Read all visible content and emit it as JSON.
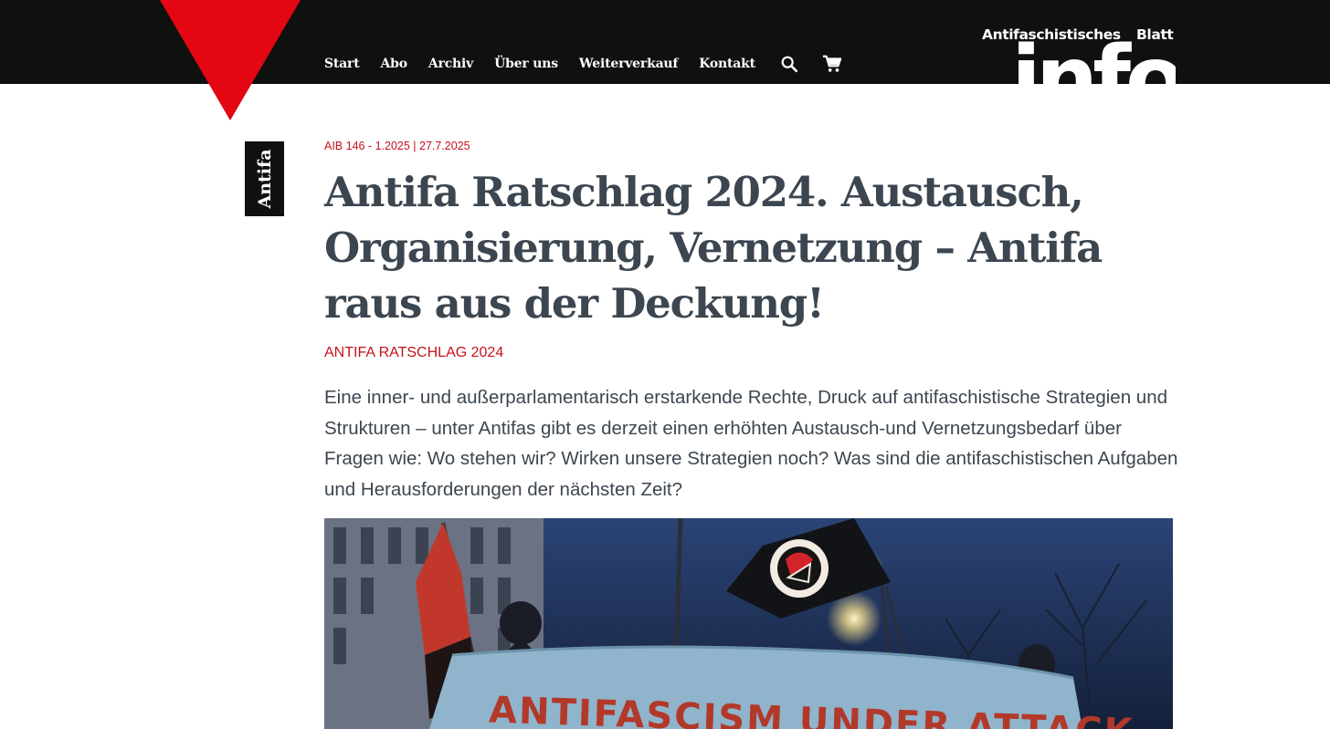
{
  "header": {
    "nav": [
      "Start",
      "Abo",
      "Archiv",
      "Über uns",
      "Weiterverkauf",
      "Kontakt"
    ],
    "search_icon": "search-icon",
    "cart_icon": "cart-icon",
    "logo_top": "Antifaschistisches",
    "logo_side": "Blatt",
    "logo_main": "info"
  },
  "colors": {
    "accent_red": "#e30613",
    "text_red": "#c4121a",
    "dark_bar": "#0e110d",
    "headline": "#3c4650"
  },
  "article": {
    "category": "Antifa",
    "meta": "AIB 146 - 1.2025 | 27.7.2025",
    "title": "Antifa Ratschlag 2024. Austausch, Organisierung, Vernetzung – Antifa raus aus der Deckung!",
    "kicker": "ANTIFA RATSCHLAG 2024",
    "lead": "Eine inner- und außerparlamentarisch erstarkende Rechte, Druck auf antifaschistische Strategien und Strukturen – unter Antifas gibt es derzeit einen erhöhten Austausch-und Vernetzungsbedarf über Fragen wie: Wo stehen wir? Wirken unsere Strategien noch? Was sind die antifaschistischen Aufgaben und Herausforderungen der nächsten Zeit?",
    "image_banner_text": "ANTIFASCISM UNDER ATTACK"
  }
}
